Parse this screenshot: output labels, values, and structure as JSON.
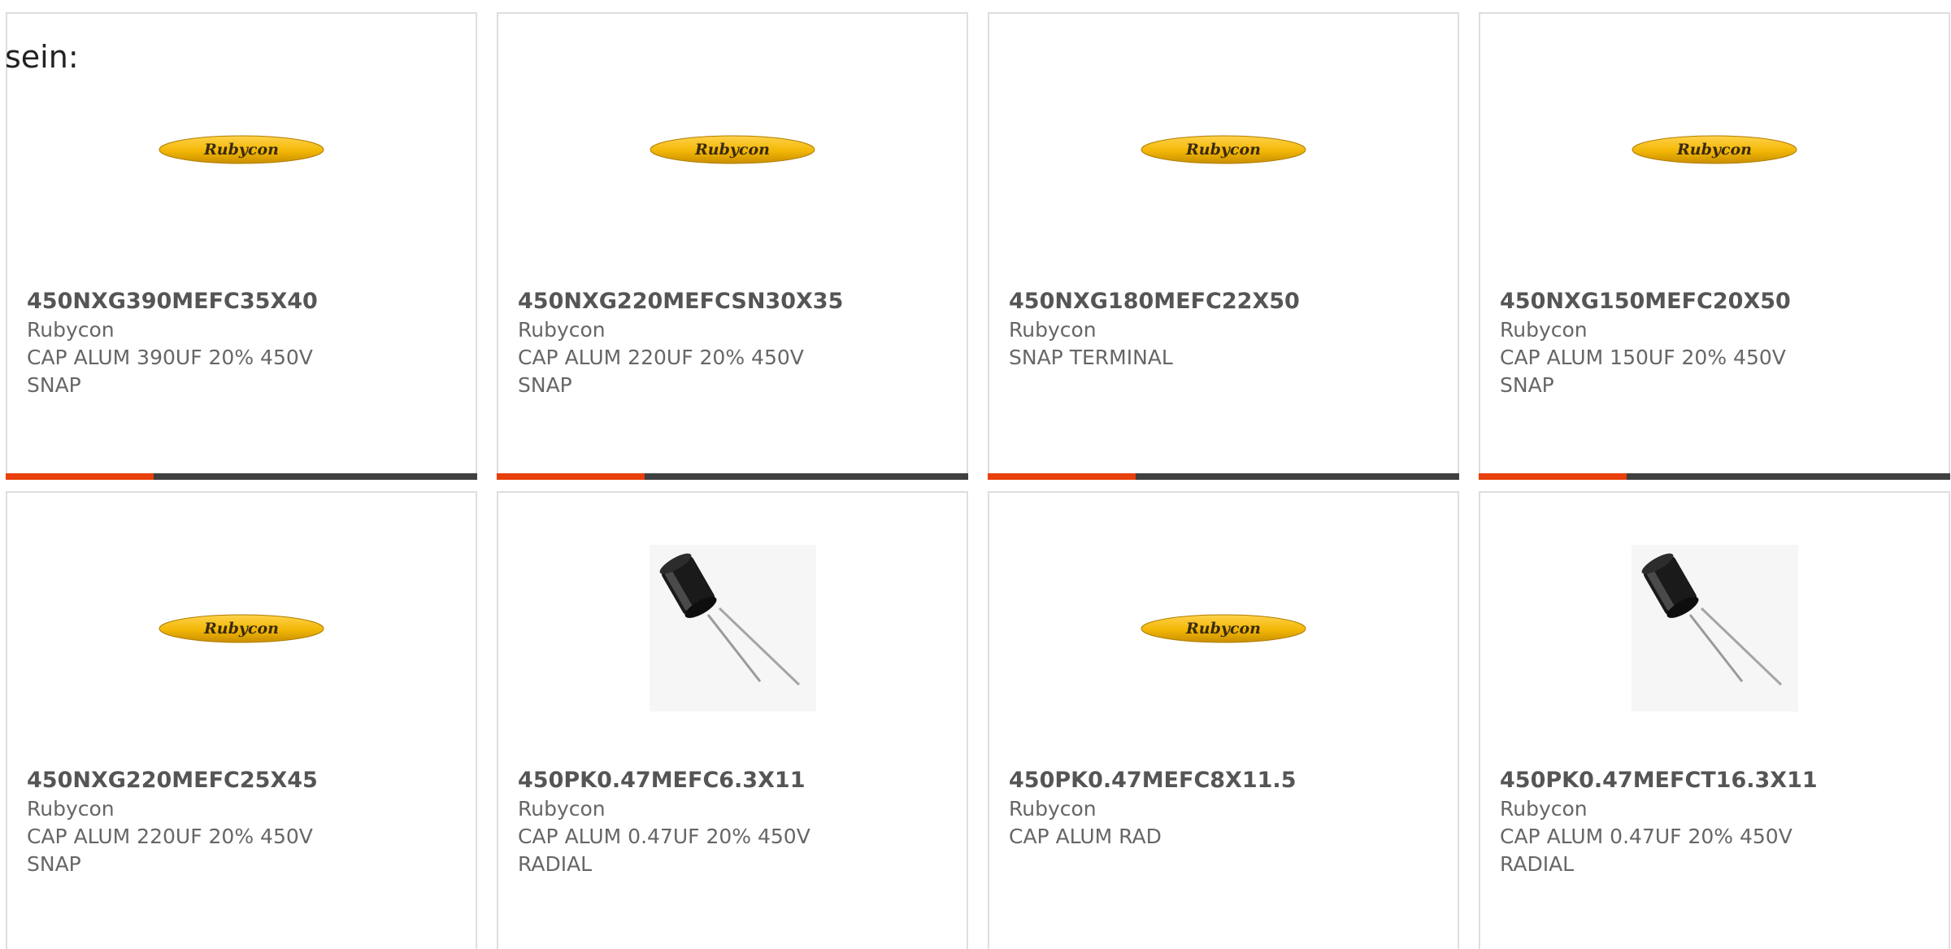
{
  "intro_text": "sein:",
  "accent_color": "#e8400c",
  "bar_color": "#404040",
  "products": [
    {
      "part": "450NXG390MEFC35X40",
      "brand": "Rubycon",
      "desc": "CAP ALUM 390UF 20% 450V\nSNAP",
      "image": "rubycon-logo",
      "accent_bar": true
    },
    {
      "part": "450NXG220MEFCSN30X35",
      "brand": "Rubycon",
      "desc": "CAP ALUM 220UF 20% 450V\nSNAP",
      "image": "rubycon-logo",
      "accent_bar": true
    },
    {
      "part": "450NXG180MEFC22X50",
      "brand": "Rubycon",
      "desc": "SNAP TERMINAL",
      "image": "rubycon-logo",
      "accent_bar": true
    },
    {
      "part": "450NXG150MEFC20X50",
      "brand": "Rubycon",
      "desc": "CAP ALUM 150UF 20% 450V\nSNAP",
      "image": "rubycon-logo",
      "accent_bar": true
    },
    {
      "part": "450NXG220MEFC25X45",
      "brand": "Rubycon",
      "desc": "CAP ALUM 220UF 20% 450V\nSNAP",
      "image": "rubycon-logo",
      "accent_bar": false
    },
    {
      "part": "450PK0.47MEFC6.3X11",
      "brand": "Rubycon",
      "desc": "CAP ALUM 0.47UF 20% 450V\nRADIAL",
      "image": "capacitor-photo",
      "accent_bar": false
    },
    {
      "part": "450PK0.47MEFC8X11.5",
      "brand": "Rubycon",
      "desc": "CAP ALUM RAD",
      "image": "rubycon-logo",
      "accent_bar": false
    },
    {
      "part": "450PK0.47MEFCT16.3X11",
      "brand": "Rubycon",
      "desc": "CAP ALUM 0.47UF 20% 450V\nRADIAL",
      "image": "capacitor-photo",
      "accent_bar": false
    }
  ]
}
